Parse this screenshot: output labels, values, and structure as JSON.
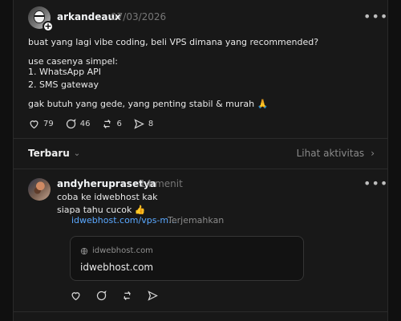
{
  "post": {
    "author": "arkandeaux",
    "date": "07/03/2026",
    "lines": [
      "buat yang lagi vibe coding, beli VPS dimana yang recommended?",
      "use casenya simpel:",
      "1. WhatsApp API",
      "2. SMS gateway",
      "gak butuh yang gede, yang penting stabil & murah 🙏"
    ],
    "counts": {
      "likes": "79",
      "comments": "46",
      "reposts": "6",
      "shares": "8"
    }
  },
  "tabs": {
    "left": "Terbaru",
    "right": "Lihat aktivitas"
  },
  "reply": {
    "author": "andyheruprasetya",
    "time": "14 menit",
    "lines": [
      "coba ke idwebhost kak",
      "siapa tahu cucok 👍"
    ],
    "link_text": "idwebhost.com/vps-m…",
    "translate_label": "Terjemahkan",
    "card": {
      "domain": "idwebhost.com",
      "title": "idwebhost.com"
    }
  }
}
